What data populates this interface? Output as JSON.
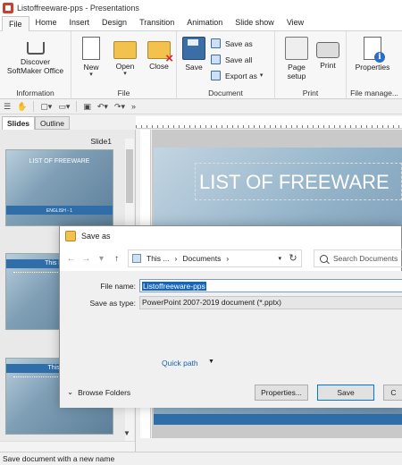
{
  "window": {
    "title": "Listoffreeware-pps - Presentations"
  },
  "ribbon_tabs": [
    "File",
    "Home",
    "Insert",
    "Design",
    "Transition",
    "Animation",
    "Slide show",
    "View"
  ],
  "ribbon": {
    "information": {
      "label": "Information",
      "discover": "Discover\nSoftMaker Office"
    },
    "file": {
      "label": "File",
      "new": "New",
      "open": "Open",
      "close": "Close"
    },
    "document": {
      "label": "Document",
      "save": "Save",
      "save_as": "Save as",
      "save_all": "Save all",
      "export_as": "Export as"
    },
    "print": {
      "label": "Print",
      "page_setup": "Page\nsetup",
      "print": "Print"
    },
    "file_manage": {
      "label": "File manage...",
      "properties": "Properties"
    }
  },
  "panel_tabs": [
    "Slides",
    "Outline"
  ],
  "slides": {
    "current_label": "Slide1",
    "thumb1_title": "LIST OF FREEWARE",
    "thumb1_sub": "ENGLISH - 1",
    "thumb2_title": "This is a S",
    "thumb3_title": "This is a"
  },
  "slide_canvas": {
    "title": "LIST OF FREEWARE"
  },
  "dialog": {
    "title": "Save as",
    "path": [
      "This ...",
      "Documents"
    ],
    "search_placeholder": "Search Documents",
    "file_name_label": "File name:",
    "file_name_value": "Listoffreeware-pps",
    "save_type_label": "Save as type:",
    "save_type_value": "PowerPoint 2007-2019 document (*.pptx)",
    "quick_path": "Quick path",
    "browse_folders": "Browse Folders",
    "properties_btn": "Properties...",
    "save_btn": "Save",
    "cancel_btn": "C"
  },
  "status": {
    "text": "Save document with a new name"
  }
}
